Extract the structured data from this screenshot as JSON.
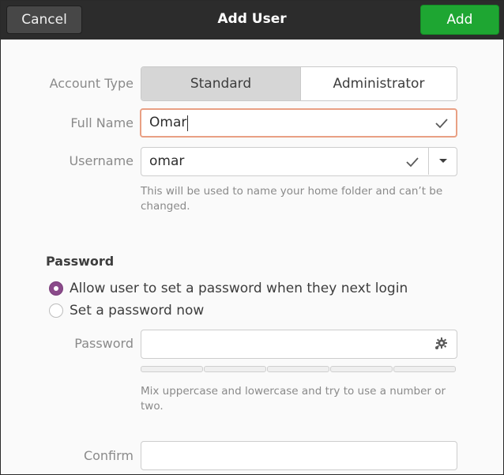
{
  "header": {
    "cancel_label": "Cancel",
    "title": "Add User",
    "add_label": "Add"
  },
  "form": {
    "account_type_label": "Account Type",
    "account_type_options": [
      "Standard",
      "Administrator"
    ],
    "account_type_selected": "Standard",
    "full_name_label": "Full Name",
    "full_name_value": "Omar",
    "username_label": "Username",
    "username_value": "omar",
    "username_hint": "This will be used to name your home folder and can’t be changed."
  },
  "password": {
    "section_title": "Password",
    "option_next_login": "Allow user to set a password when they next login",
    "option_set_now": "Set a password now",
    "selected_option": "next_login",
    "password_label": "Password",
    "password_value": "",
    "strength_hint": "Mix uppercase and lowercase and try to use a number or two.",
    "confirm_label": "Confirm",
    "confirm_value": ""
  },
  "colors": {
    "header_bg": "#2c2c2c",
    "add_button": "#1ea632",
    "radio_selected": "#8a4a8a",
    "focus_border": "#e9a084"
  },
  "icons": {
    "entry_valid": "check-icon",
    "combo": "chevron-down-icon",
    "generate": "gear-icon"
  }
}
